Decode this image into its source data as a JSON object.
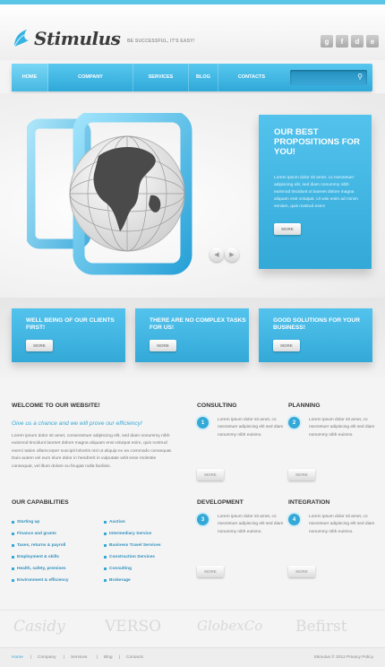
{
  "header": {
    "logo_text": "Stimulus",
    "tagline": "BE SUCCESSFUL, IT'S EASY!",
    "social": [
      "g",
      "f",
      "d",
      "e"
    ]
  },
  "nav": {
    "items": [
      "HOME",
      "COMPANY",
      "SERVICES",
      "BLOG",
      "CONTACTS"
    ],
    "active": "HOME",
    "search_placeholder": ""
  },
  "hero": {
    "title": "OUR BEST PROPOSITIONS FOR YOU!",
    "text": "Lorem ipsum dolor sit amet, co nsectetuer adipiscing elit, sed diam nonummy nibh euismod tincidunt ut laoreet dolore magna aliquam erat volutpat. Ut wisi enim ad minim veniam, quis nostrud exerc",
    "more": "MORE"
  },
  "promos": [
    {
      "title": "WELL BEING OF OUR CLIENTS FIRST!",
      "more": "MORE"
    },
    {
      "title": "THERE ARE NO COMPLEX TASKS FOR US!",
      "more": "MORE"
    },
    {
      "title": "GOOD SOLUTIONS FOR YOUR BUSINESS!",
      "more": "MORE"
    }
  ],
  "welcome": {
    "title": "WELCOME TO OUR WEBSITE!",
    "subtitle": "Give us a chance and we will prove our efficiency!",
    "text": "Lorem ipsum dolor sit amet, consectetuer adipiscing elit, sed diam nonummy nibh euismod tincidunt laoreet dolore magna aliquam erat volutpat enim, quis nostrud exerci tation ullamcorper suscipit lobortis nisl ut aliquip ex ea commodo consequat. Duis autem vel eum iriure dolor in hendrerit in vulputate velit esse molestie consequat, vel illum dolore eu feugiat nulla facilisis."
  },
  "capabilities": {
    "title": "OUR CAPABILITIES",
    "col1": [
      "Starting up",
      "Finance and grants",
      "Taxes, returns & payroll",
      "Employment & skills",
      "Health, safety, premises",
      "Environment & efficiency"
    ],
    "col2": [
      "Auction",
      "Intermediary Service",
      "Business Travel Services",
      "Construction Services",
      "Consulting",
      "Brokerage"
    ]
  },
  "services": [
    {
      "num": "1",
      "title": "CONSULTING",
      "text": "Lorem ipsum dolor sit amet, co nsectetuer adipiscing elit sed diam nonummy nibh euismo.",
      "more": "MORE"
    },
    {
      "num": "2",
      "title": "PLANNING",
      "text": "Lorem ipsum dolor sit amet, co nsectetuer adipiscing elit sed diam nonummy nibh euismo.",
      "more": "MORE"
    },
    {
      "num": "3",
      "title": "DEVELOPMENT",
      "text": "Lorem ipsum dolor sit amet, co nsectetuer adipiscing elit sed diam nonummy nibh euismo.",
      "more": "MORE"
    },
    {
      "num": "4",
      "title": "INTEGRATION",
      "text": "Lorem ipsum dolor sit amet, co nsectetuer adipiscing elit sed diam nonummy nibh euismo.",
      "more": "MORE"
    }
  ],
  "clients": [
    "Casidy",
    "VERSO",
    "GlobexCo",
    "Befirst"
  ],
  "footer": {
    "links": [
      "Home",
      "Company",
      "Services",
      "Blog",
      "Contacts"
    ],
    "copyright": "Stimulus © 2012 Privacy Policy"
  }
}
